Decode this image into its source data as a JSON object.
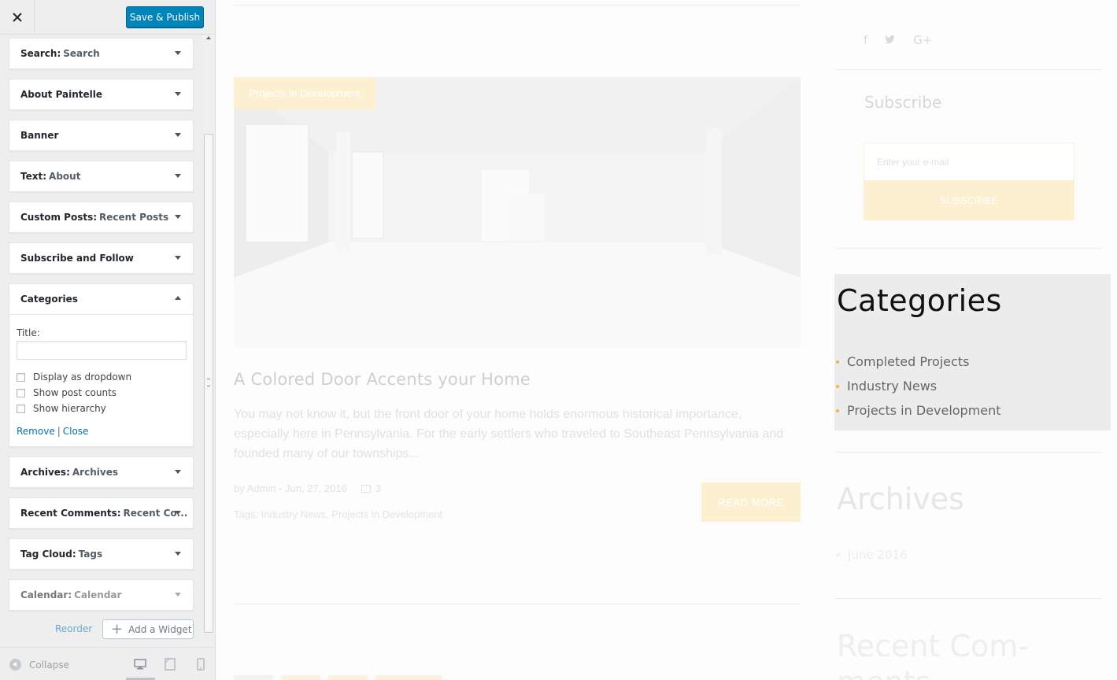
{
  "topbar": {
    "close_icon": "close-icon",
    "save_label": "Save & Publish"
  },
  "widgets": [
    {
      "type": "Search",
      "title": "Search",
      "expanded": false
    },
    {
      "type": "About Paintelle",
      "title": "",
      "expanded": false
    },
    {
      "type": "Banner",
      "title": "",
      "expanded": false
    },
    {
      "type": "Text",
      "title": "About",
      "expanded": false
    },
    {
      "type": "Custom Posts",
      "title": "Recent Posts",
      "expanded": false
    },
    {
      "type": "Subscribe and Follow",
      "title": "",
      "expanded": false
    },
    {
      "type": "Categories",
      "title": "",
      "expanded": true
    },
    {
      "type": "Archives",
      "title": "Archives",
      "expanded": false
    },
    {
      "type": "Recent Comments",
      "title": "Recent Co...",
      "expanded": false
    },
    {
      "type": "Tag Cloud",
      "title": "Tags",
      "expanded": false
    },
    {
      "type": "Calendar",
      "title": "Calendar",
      "expanded": false
    }
  ],
  "categories_form": {
    "title_label": "Title:",
    "title_value": "",
    "options": [
      {
        "label": "Display as dropdown",
        "checked": false
      },
      {
        "label": "Show post counts",
        "checked": false
      },
      {
        "label": "Show hierarchy",
        "checked": false
      }
    ],
    "remove_label": "Remove",
    "separator": "|",
    "close_label": "Close"
  },
  "actions": {
    "reorder_label": "Reorder",
    "add_widget_label": "Add a Widget"
  },
  "footer": {
    "collapse_label": "Collapse",
    "devices": [
      "desktop-icon",
      "tablet-icon",
      "mobile-icon"
    ],
    "active_device": "desktop"
  },
  "preview": {
    "post": {
      "category_badge": "Projects in Development",
      "title": "A Colored Door Accents your Home",
      "excerpt": "You may not know it, but the front door of your home holds enormous historical importance, especially here in Pennsylvania. For the early settlers who traveled to Southeast Pennsylvania and founded many of our townships...",
      "meta": "by Admin - Jun, 27, 2016",
      "comments": "3",
      "tags": "Tags: Industry News, Projects in Development",
      "read_more": "READ MORE"
    },
    "social_icons": [
      "f",
      "twitter-icon",
      "G+"
    ],
    "subscribe": {
      "title": "Subscribe",
      "placeholder": "Enter your e-mail",
      "button": "SUBSCRIBE"
    },
    "categories": {
      "title": "Categories",
      "items": [
        "Completed Projects",
        "Industry News",
        "Projects in Development"
      ]
    },
    "archives": {
      "title": "Archives",
      "items": [
        "June 2016"
      ]
    },
    "recent_comments": {
      "title": "Recent Com- ments"
    }
  },
  "colors": {
    "primary_button": "#0085ba",
    "accent": "#f2b53a",
    "highlight_box": "#ececec"
  }
}
